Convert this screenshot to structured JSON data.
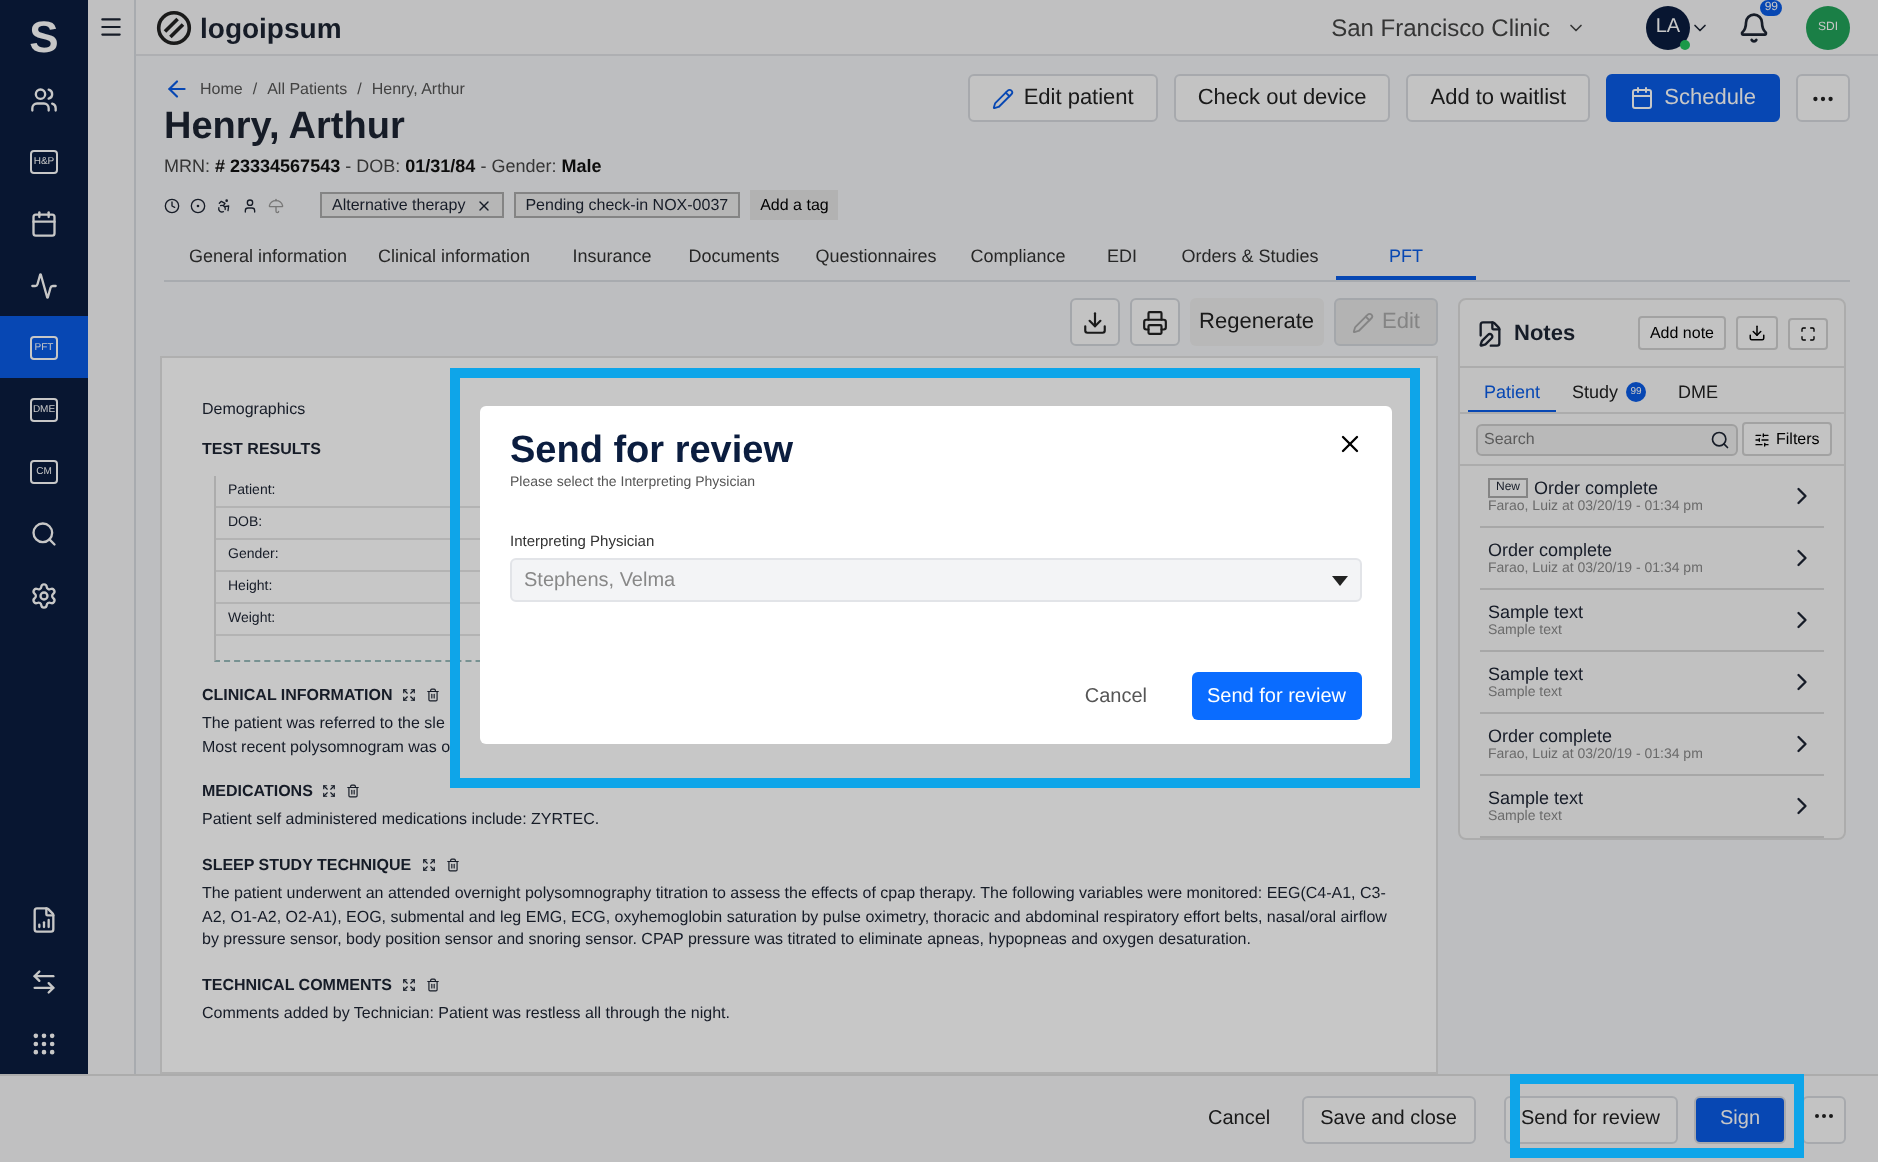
{
  "sidebar": {
    "logo": "S",
    "items": [
      {
        "kind": "users",
        "selected": false
      },
      {
        "kind": "glyph",
        "label": "H&P",
        "selected": false
      },
      {
        "kind": "calendar",
        "selected": false
      },
      {
        "kind": "pulse",
        "selected": false
      },
      {
        "kind": "glyph",
        "label": "PFT",
        "selected": true
      },
      {
        "kind": "glyph",
        "label": "DME",
        "selected": false
      },
      {
        "kind": "glyph",
        "label": "CM",
        "selected": false
      },
      {
        "kind": "search",
        "selected": false
      },
      {
        "kind": "settings",
        "selected": false
      }
    ],
    "bottom_items": [
      {
        "kind": "report"
      },
      {
        "kind": "swap"
      },
      {
        "kind": "grid"
      }
    ]
  },
  "top_bar": {
    "logo": "logoipsum",
    "clinic": "San Francisco Clinic",
    "user_initials": "LA",
    "notifications": "99",
    "org_initials": "SDI"
  },
  "breadcrumb": [
    "Home",
    "All Patients",
    "Henry, Arthur"
  ],
  "breadcrumb_separator": "/",
  "patient": {
    "name": "Henry, Arthur",
    "mrn_label": "MRN:",
    "mrn": "# 23334567543",
    "dob_label": "DOB:",
    "dob": "01/31/84",
    "gender_label": "Gender:",
    "gender": "Male",
    "separator": "-"
  },
  "tags": [
    {
      "label": "Alternative therapy",
      "removable": true
    },
    {
      "label": "Pending check-in NOX-0037",
      "removable": false
    }
  ],
  "add_tag": "Add a tag",
  "actions": [
    {
      "label": "Edit patient",
      "kind": "edit"
    },
    {
      "label": "Check out device",
      "kind": "plain"
    },
    {
      "label": "Add to waitlist",
      "kind": "plain"
    },
    {
      "label": "Schedule",
      "kind": "primary"
    }
  ],
  "tabs": [
    {
      "label": "General information",
      "selected": false
    },
    {
      "label": "Clinical information",
      "selected": false
    },
    {
      "label": "Insurance",
      "selected": false
    },
    {
      "label": "Documents",
      "selected": false
    },
    {
      "label": "Questionnaires",
      "selected": false
    },
    {
      "label": "Compliance",
      "selected": false
    },
    {
      "label": "EDI",
      "selected": false
    },
    {
      "label": "Orders & Studies",
      "selected": false
    },
    {
      "label": "PFT",
      "selected": true
    }
  ],
  "doc_toolbar": {
    "regenerate": "Regenerate",
    "edit": {
      "label": "Edit",
      "disabled": true
    }
  },
  "document": {
    "heading": "Demographics",
    "results_title": "TEST RESULTS",
    "result_rows": [
      "Patient:",
      "DOB:",
      "Gender:",
      "Height:",
      "Weight:"
    ],
    "sections": [
      {
        "title": "CLINICAL INFORMATION",
        "lines": [
          "The patient was referred to the sle",
          "Most recent polysomnogram was o"
        ]
      },
      {
        "title": "MEDICATIONS",
        "lines": [
          "Patient self administered medications include: ZYRTEC."
        ]
      },
      {
        "title": "SLEEP STUDY TECHNIQUE",
        "lines": [
          "The patient underwent an attended overnight polysomnography titration to assess the effects of cpap therapy. The following variables were monitored: EEG(C4-A1, C3-A2, O1-A2, O2-A1), EOG, submental and leg EMG, ECG, oxyhemoglobin saturation by pulse oximetry, thoracic and abdominal respiratory effort belts, nasal/oral airflow by pressure sensor, body position sensor and snoring sensor. CPAP pressure was titrated to eliminate apneas, hypopneas and oxygen desaturation."
        ]
      },
      {
        "title": "TECHNICAL COMMENTS",
        "lines": [
          "Comments added by Technician: Patient was restless all through the night."
        ]
      }
    ]
  },
  "notes": {
    "title": "Notes",
    "add": "Add note",
    "tabs": [
      {
        "label": "Patient",
        "selected": true
      },
      {
        "label": "Study",
        "badge": "99",
        "selected": false
      },
      {
        "label": "DME",
        "selected": false
      }
    ],
    "search_placeholder": "Search",
    "filters": "Filters",
    "items": [
      {
        "badge": "New",
        "title": "Order complete",
        "subtitle": "Farao, Luiz at 03/20/19 - 01:34 pm"
      },
      {
        "title": "Order complete",
        "subtitle": "Farao, Luiz at 03/20/19 - 01:34 pm"
      },
      {
        "title": "Sample text",
        "subtitle": "Sample text"
      },
      {
        "title": "Sample text",
        "subtitle": "Sample text"
      },
      {
        "title": "Order complete",
        "subtitle": "Farao, Luiz at 03/20/19 - 01:34 pm"
      },
      {
        "title": "Sample text",
        "subtitle": "Sample text"
      }
    ]
  },
  "footer": {
    "cancel": "Cancel",
    "save": "Save and close",
    "review": "Send for review",
    "sign": "Sign"
  },
  "modal": {
    "title": "Send for review",
    "subtitle": "Please select the Interpreting Physician",
    "field_label": "Interpreting Physician",
    "field_value": "Stephens, Velma",
    "cancel": "Cancel",
    "submit": "Send for review"
  }
}
